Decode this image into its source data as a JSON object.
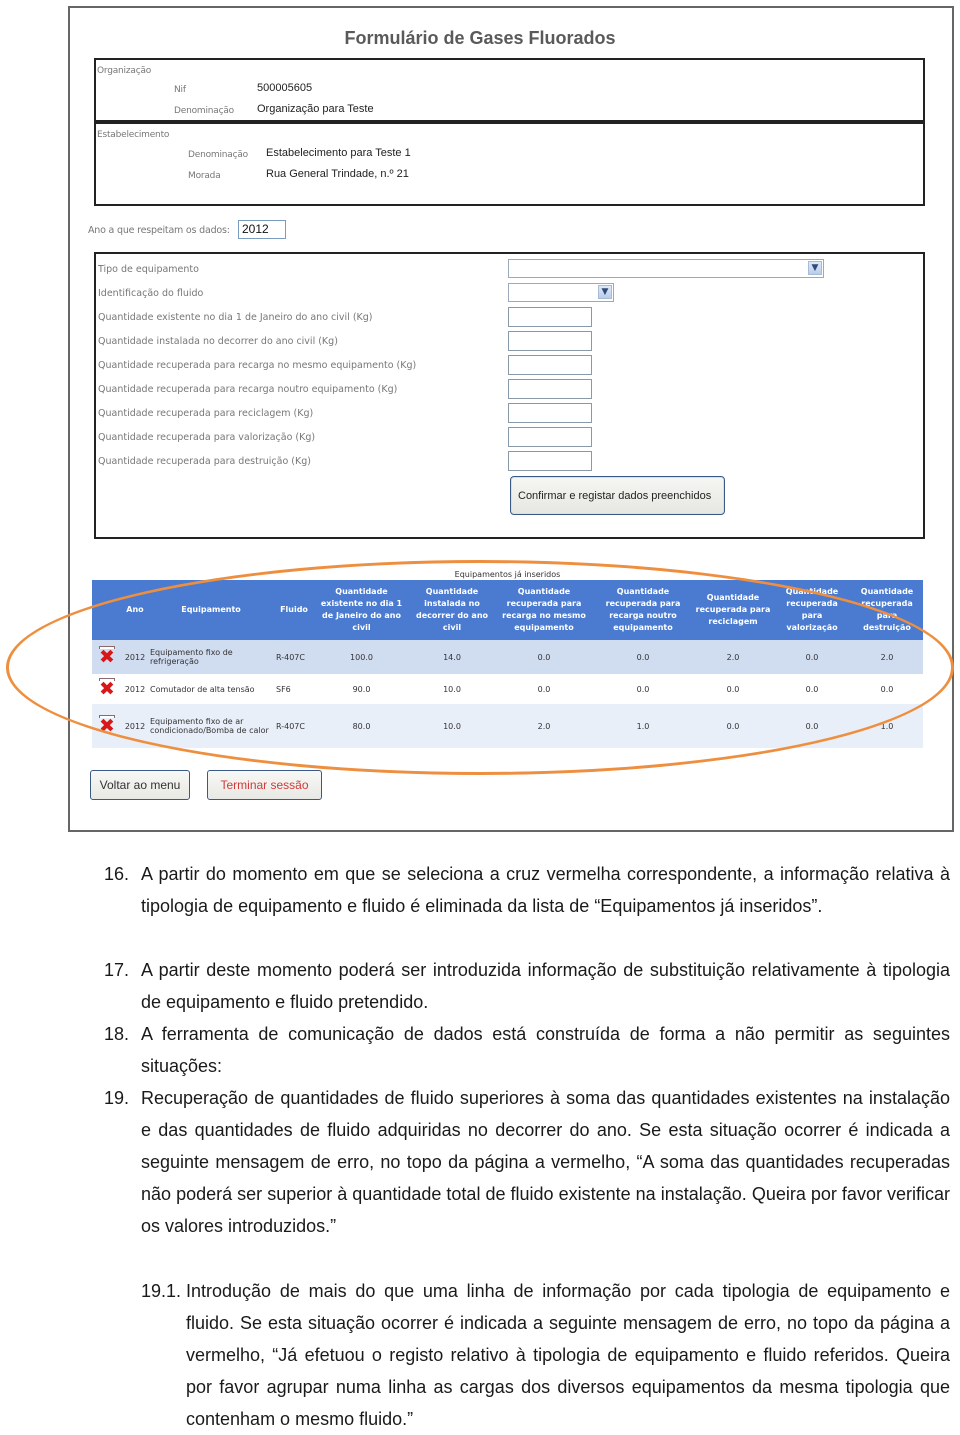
{
  "form": {
    "title": "Formulário de Gases Fluorados",
    "organization": {
      "section_label": "Organização",
      "nif_label": "Nif",
      "nif_value": "500005605",
      "name_label": "Denominação",
      "name_value": "Organização para Teste"
    },
    "establishment": {
      "section_label": "Estabelecimento",
      "name_label": "Denominação",
      "name_value": "Estabelecimento para Teste 1",
      "address_label": "Morada",
      "address_value": "Rua General Trindade, n.º 21"
    },
    "year_label": "Ano a que respeitam os dados:",
    "year_value": "2012",
    "fields": [
      {
        "label": "Tipo de equipamento",
        "type": "select",
        "value": ""
      },
      {
        "label": "Identificação do fluido",
        "type": "select",
        "value": ""
      },
      {
        "label": "Quantidade existente no dia 1 de Janeiro do ano civil (Kg)",
        "type": "text",
        "value": ""
      },
      {
        "label": "Quantidade instalada no decorrer do ano civil (Kg)",
        "type": "text",
        "value": ""
      },
      {
        "label": "Quantidade recuperada para recarga no mesmo equipamento (Kg)",
        "type": "text",
        "value": ""
      },
      {
        "label": "Quantidade recuperada para recarga noutro equipamento (Kg)",
        "type": "text",
        "value": ""
      },
      {
        "label": "Quantidade recuperada para reciclagem (Kg)",
        "type": "text",
        "value": ""
      },
      {
        "label": "Quantidade recuperada para valorização (Kg)",
        "type": "text",
        "value": ""
      },
      {
        "label": "Quantidade recuperada para destruição (Kg)",
        "type": "text",
        "value": ""
      }
    ],
    "confirm_button": "Confirmar e registar dados preenchidos"
  },
  "table": {
    "caption": "Equipamentos já inseridos",
    "headers": [
      "",
      "Ano",
      "Equipamento",
      "Fluido",
      "Quantidade existente no dia 1 de Janeiro do ano civil",
      "Quantidade instalada no decorrer do ano civil",
      "Quantidade recuperada para recarga no mesmo equipamento",
      "Quantidade recuperada para recarga noutro equipamento",
      "Quantidade recuperada para reciclagem",
      "Quantidade recuperada para valorização",
      "Quantidade recuperada para destruição"
    ],
    "rows": [
      {
        "ano": "2012",
        "equipamento": "Equipamento fixo de refrigeração",
        "fluido": "R-407C",
        "values": [
          "100.0",
          "14.0",
          "0.0",
          "0.0",
          "2.0",
          "0.0",
          "2.0"
        ]
      },
      {
        "ano": "2012",
        "equipamento": "Comutador de alta tensão",
        "fluido": "SF6",
        "values": [
          "90.0",
          "10.0",
          "0.0",
          "0.0",
          "0.0",
          "0.0",
          "0.0"
        ]
      },
      {
        "ano": "2012",
        "equipamento": "Equipamento fixo de ar condicionado/Bomba de calor",
        "fluido": "R-407C",
        "values": [
          "80.0",
          "10.0",
          "2.0",
          "1.0",
          "0.0",
          "0.0",
          "1.0"
        ]
      }
    ],
    "delete_icon": "red-x-delete-icon"
  },
  "buttons": {
    "back": "Voltar ao menu",
    "logout": "Terminar sessão"
  },
  "colors": {
    "table_header": "#4a7bd0",
    "highlight": "#ee8f3f",
    "logout_text": "#d23a3a",
    "delete_icon": "#d81818"
  },
  "document": {
    "items": [
      {
        "number": "16.",
        "text": "A partir do momento em que se seleciona a cruz vermelha correspondente, a informação relativa à tipologia de equipamento e fluido é eliminada da lista de “Equipamentos já inseridos”."
      },
      {
        "number": "17.",
        "text": "A partir deste momento poderá ser introduzida informação de substituição relativamente à tipologia de equipamento e fluido pretendido."
      },
      {
        "number": "18.",
        "text": "A ferramenta de comunicação de dados está construída de forma a não permitir as seguintes situações:"
      },
      {
        "number": "19.",
        "text": "Recuperação de quantidades de fluido superiores à soma das quantidades existentes na instalação e das quantidades de fluido adquiridas no decorrer do ano. Se esta situação ocorrer é indicada a seguinte mensagem de erro, no topo da página a vermelho, “A soma das quantidades recuperadas não poderá ser superior à quantidade total de fluido existente na instalação. Queira por favor verificar os valores introduzidos.”"
      },
      {
        "number": "19.1.",
        "text": "Introdução de mais do que uma linha de informação por cada tipologia de equipamento e fluido. Se esta situação ocorrer é indicada a seguinte mensagem de erro, no topo da página a vermelho, “Já efetuou o registo relativo à tipologia de equipamento e fluido referidos. Queira por favor agrupar numa linha as cargas dos diversos equipamentos da mesma tipologia que contenham o mesmo fluido.”"
      }
    ]
  }
}
